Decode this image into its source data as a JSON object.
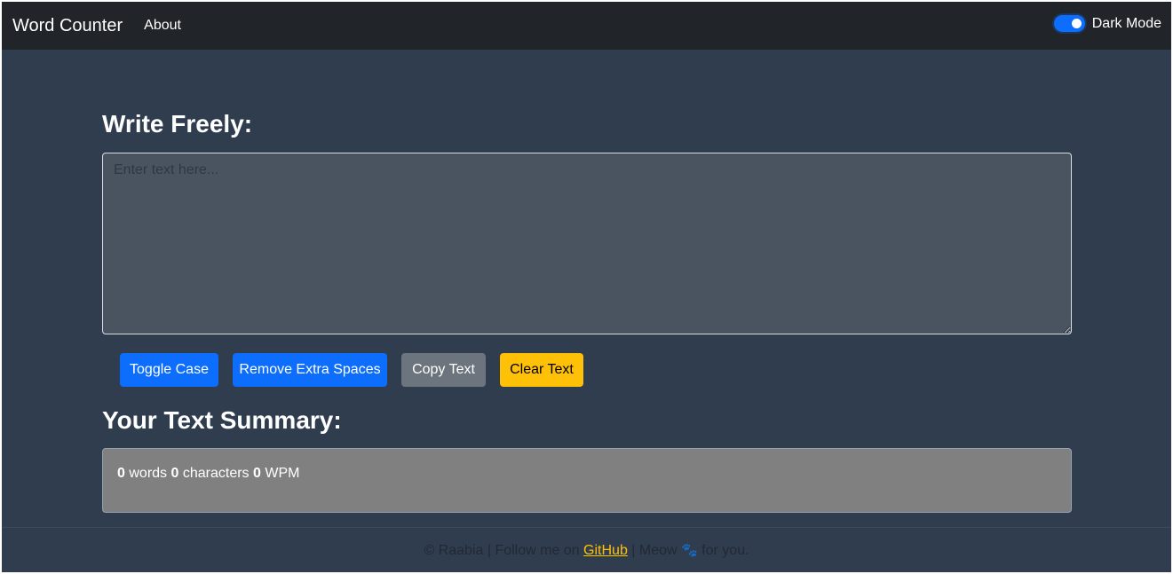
{
  "navbar": {
    "brand": "Word Counter",
    "about": "About",
    "dark_mode_label": "Dark Mode",
    "dark_mode_enabled": true,
    "colors": {
      "background": "#212529",
      "toggle": "#0d6efd"
    }
  },
  "editor": {
    "heading": "Write Freely:",
    "placeholder": "Enter text here...",
    "value": ""
  },
  "buttons": {
    "toggle_case": "Toggle Case",
    "remove_extra_spaces": "Remove Extra Spaces",
    "copy_text": "Copy Text",
    "clear_text": "Clear Text"
  },
  "summary": {
    "heading": "Your Text Summary:",
    "word_count": "0",
    "word_label": "words",
    "character_count": "0",
    "character_label": "characters",
    "wpm_count": "0",
    "wpm_label": "WPM"
  },
  "footer": {
    "before_link": "© Raabia | Follow me on",
    "link_text": "GitHub",
    "after_link_before_icon": "| Meow",
    "icon": "paw-icon",
    "icon_glyph": "🐾",
    "after_icon": "for you."
  },
  "theme": {
    "page_background": "#2f3d4f",
    "primary": "#0d6efd",
    "secondary": "#6c757d",
    "warning": "#ffc107",
    "summary_background": "#808080"
  }
}
